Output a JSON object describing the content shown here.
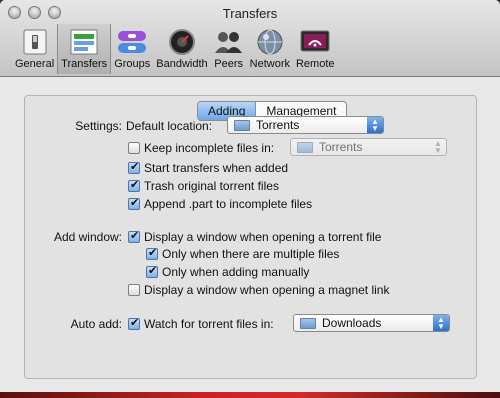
{
  "window": {
    "title": "Transfers"
  },
  "toolbar": {
    "items": [
      {
        "label": "General",
        "icon": "switch-icon"
      },
      {
        "label": "Transfers",
        "icon": "transfers-icon"
      },
      {
        "label": "Groups",
        "icon": "groups-icon"
      },
      {
        "label": "Bandwidth",
        "icon": "speedometer-icon"
      },
      {
        "label": "Peers",
        "icon": "people-icon"
      },
      {
        "label": "Network",
        "icon": "globe-icon"
      },
      {
        "label": "Remote",
        "icon": "remote-icon"
      }
    ]
  },
  "tabs": {
    "adding": "Adding",
    "management": "Management"
  },
  "settings": {
    "section_label": "Settings:",
    "default_location_label": "Default location:",
    "default_location_value": "Torrents",
    "keep_incomplete_label": "Keep incomplete files in:",
    "keep_incomplete_checked": false,
    "keep_incomplete_value": "Torrents",
    "start_transfers_label": "Start transfers when added",
    "start_transfers_checked": true,
    "trash_original_label": "Trash original torrent files",
    "trash_original_checked": true,
    "append_part_label": "Append .part to incomplete files",
    "append_part_checked": true
  },
  "add_window": {
    "section_label": "Add window:",
    "display_torrent_label": "Display a window when opening a torrent file",
    "display_torrent_checked": true,
    "multiple_files_label": "Only when there are multiple files",
    "multiple_files_checked": true,
    "adding_manually_label": "Only when adding manually",
    "adding_manually_checked": true,
    "display_magnet_label": "Display a window when opening a magnet link",
    "display_magnet_checked": false
  },
  "auto_add": {
    "section_label": "Auto add:",
    "watch_label": "Watch for torrent files in:",
    "watch_checked": true,
    "watch_value": "Downloads"
  }
}
